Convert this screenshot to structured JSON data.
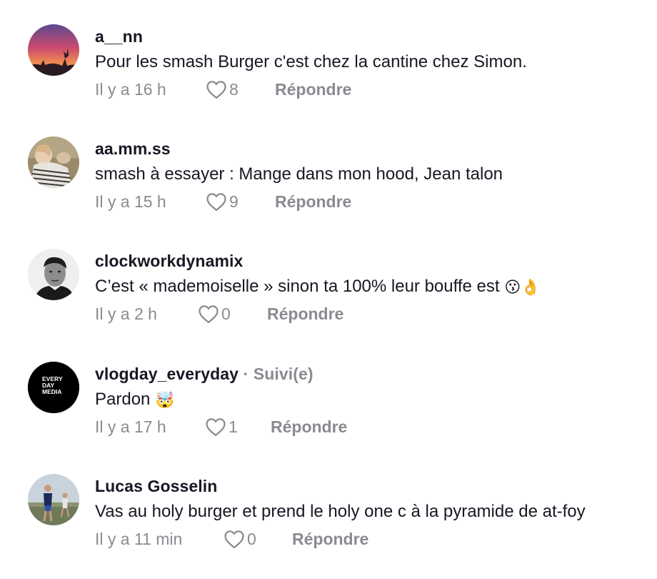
{
  "comments": [
    {
      "username": "a__nn",
      "text": "Pour les smash Burger c'est chez la cantine chez Simon.",
      "time": "Il y a 16 h",
      "likes": "8",
      "reply_label": "Répondre",
      "avatar": "sunset-photo"
    },
    {
      "username": "aa.mm.ss",
      "text": "smash à essayer : Mange dans mon hood, Jean talon",
      "time": "Il y a 15 h",
      "likes": "9",
      "reply_label": "Répondre",
      "avatar": "person-striped-shirt-photo"
    },
    {
      "username": "clockworkdynamix",
      "text": "C’est « mademoiselle » sinon ta 100% leur bouffe est",
      "emoji": "😗👌",
      "time": "Il y a 2 h",
      "likes": "0",
      "reply_label": "Répondre",
      "avatar": "bw-portrait-photo"
    },
    {
      "username": "vlogday_everyday",
      "followed_label": " · Suivi(e)",
      "text": "Pardon",
      "emoji": "🤯",
      "time": "Il y a 17 h",
      "likes": "1",
      "reply_label": "Répondre",
      "avatar": "everyday-media-logo",
      "avatar_logo": "EVERY\nDAY\nMEDIA"
    },
    {
      "username": "Lucas Gosselin",
      "text": "Vas au holy burger et prend le holy one c à la pyramide de at-foy",
      "time": "Il y a 11 min",
      "likes": "0",
      "reply_label": "Répondre",
      "avatar": "runners-photo"
    }
  ]
}
